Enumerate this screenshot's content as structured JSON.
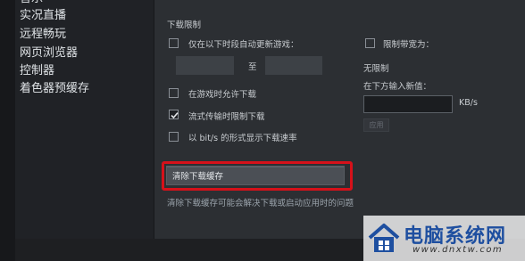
{
  "sidebar": {
    "items": [
      {
        "label": "音乐"
      },
      {
        "label": "实况直播"
      },
      {
        "label": "远程畅玩"
      },
      {
        "label": "网页浏览器"
      },
      {
        "label": "控制器"
      },
      {
        "label": "着色器预缓存"
      }
    ]
  },
  "downloads": {
    "section_title": "下载限制",
    "schedule_label": "仅在以下时段自动更新游戏：",
    "schedule_separator": "至",
    "limit_bandwidth_label": "限制带宽为：",
    "no_limit_text": "无限制",
    "enter_new_value_label": "在下方输入新值：",
    "kb_unit": "KB/s",
    "kb_value": "",
    "apply_label": "应用",
    "allow_during_game_label": "在游戏时允许下载",
    "throttle_streaming_label": "流式传输时限制下载",
    "throttle_streaming_checked": true,
    "bits_label": "以 bit/s 的形式显示下载速率",
    "clear_cache_label": "清除下载缓存",
    "clear_cache_hint": "清除下载缓存可能会解决下载或启动应用时的问题"
  },
  "watermark": {
    "title": "电脑系统网",
    "url": "www.dnxtw.com"
  },
  "colors": {
    "highlight": "#d6111a",
    "watermark_blue": "#1e4fa0"
  }
}
